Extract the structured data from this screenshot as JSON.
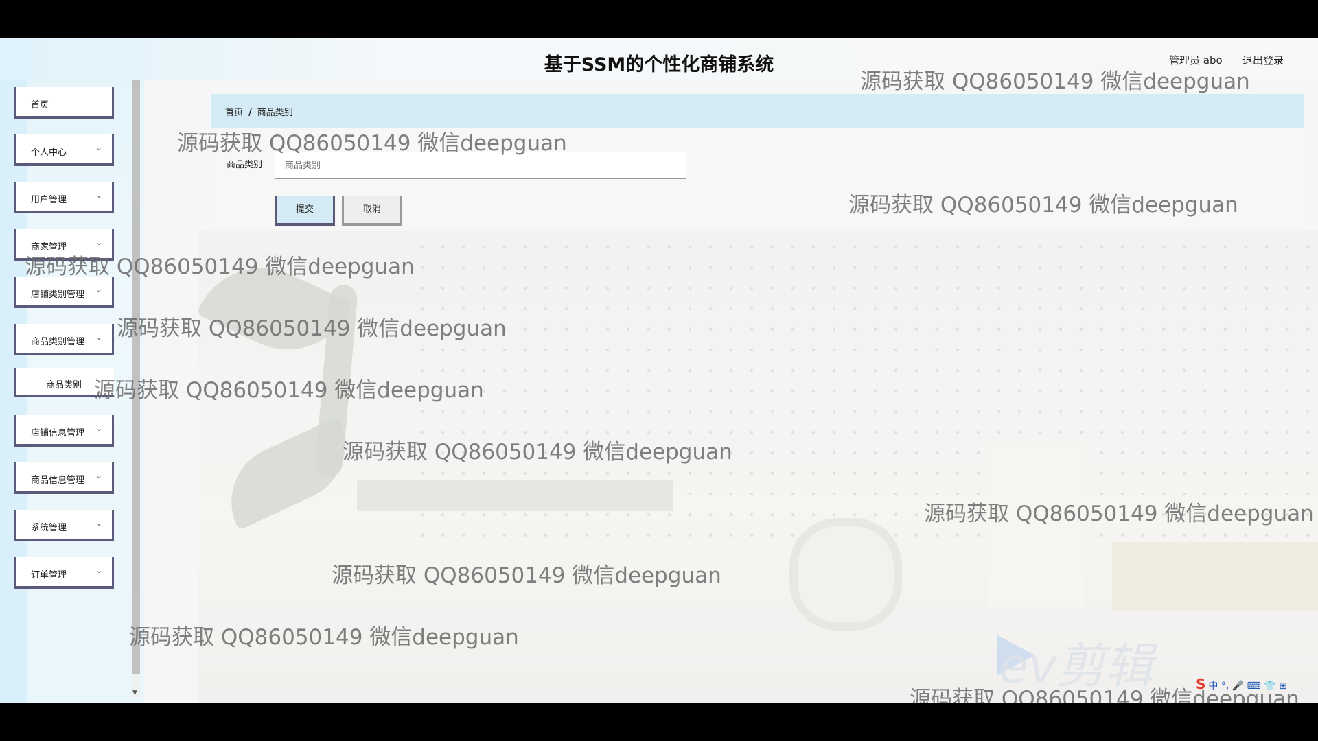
{
  "header": {
    "title": "基于SSM的个性化商铺系统",
    "admin": "管理员 abo",
    "logout": "退出登录"
  },
  "sidebar": {
    "items": [
      {
        "label": "首页",
        "has_chevron": false
      },
      {
        "label": "个人中心",
        "has_chevron": true
      },
      {
        "label": "用户管理",
        "has_chevron": true
      },
      {
        "label": "商家管理",
        "has_chevron": true
      },
      {
        "label": "店铺类别管理",
        "has_chevron": true
      },
      {
        "label": "商品类别管理",
        "has_chevron": true
      },
      {
        "label": "店铺信息管理",
        "has_chevron": true
      },
      {
        "label": "商品信息管理",
        "has_chevron": true
      },
      {
        "label": "系统管理",
        "has_chevron": true
      },
      {
        "label": "订单管理",
        "has_chevron": true
      }
    ],
    "submenu": {
      "label": "商品类别"
    }
  },
  "breadcrumb": {
    "home": "首页",
    "separator": "/",
    "current": "商品类别"
  },
  "form": {
    "field_label": "商品类别",
    "field_value": "",
    "field_placeholder": "商品类别",
    "submit_label": "提交",
    "cancel_label": "取消"
  },
  "watermark": {
    "text": "源码获取 QQ86050149 微信deepguan"
  },
  "overlay": {
    "ev_logo": "ev剪辑",
    "ime": "中 °, 🎤 ⌨ 👕 ⊞"
  },
  "colors": {
    "header_gradient_start": "#dff2fb",
    "breadcrumb_bg": "#d4ebf5",
    "menu_border": "#5b5a7a"
  }
}
